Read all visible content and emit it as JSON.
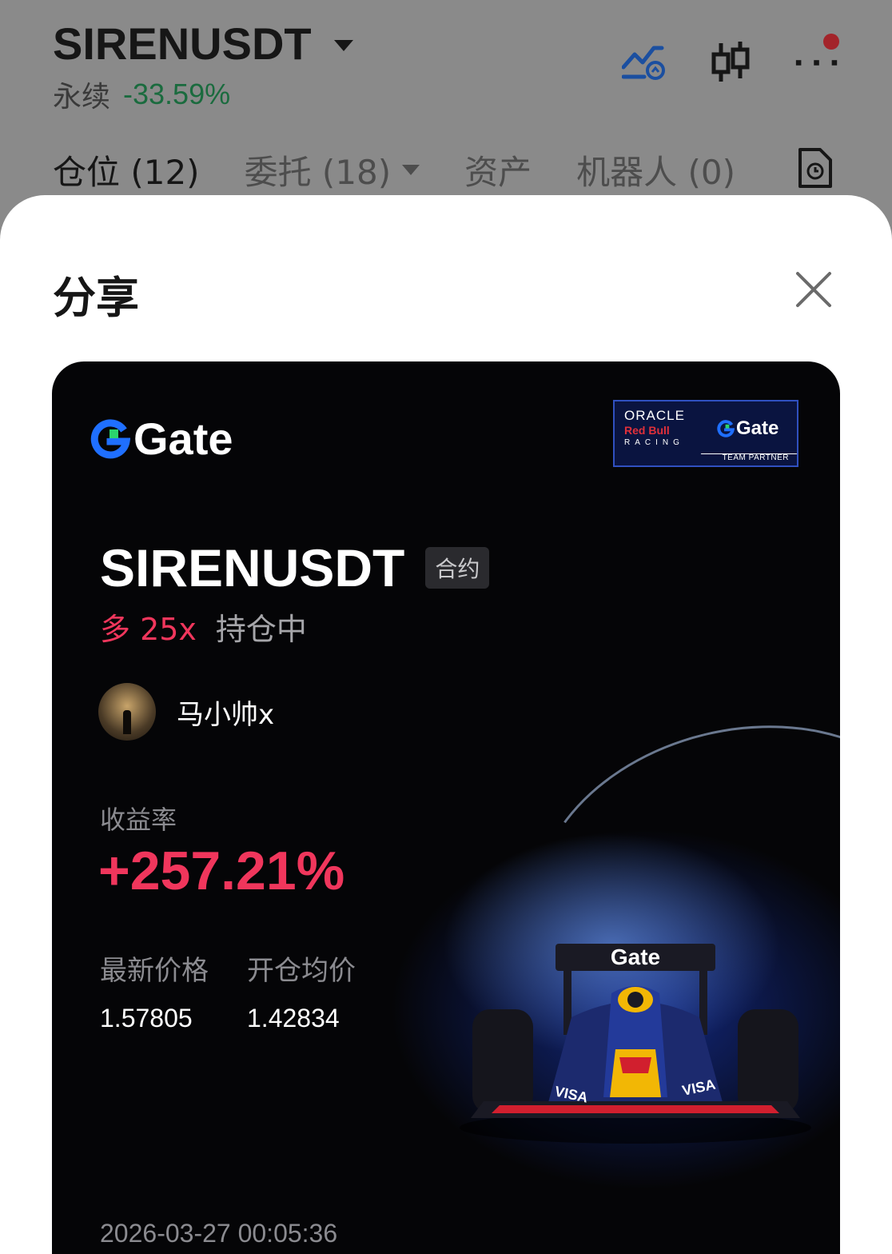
{
  "header": {
    "symbol": "SIRENUSDT",
    "contract_type": "永续",
    "change": "-33.59%"
  },
  "tabs": [
    {
      "label": "仓位 (12)"
    },
    {
      "label": "委托 (18)"
    },
    {
      "label": "资产"
    },
    {
      "label": "机器人 (0)"
    }
  ],
  "share_sheet": {
    "title": "分享"
  },
  "card": {
    "brand": "Gate",
    "partner": {
      "line1": "ORACLE",
      "line2": "Red Bull",
      "line3": "RACING",
      "brand": "Gate",
      "tag": "TEAM PARTNER"
    },
    "pair": "SIRENUSDT",
    "badge": "合约",
    "direction": "多 25x",
    "status": "持仓中",
    "username": "马小帅x",
    "roi_label": "收益率",
    "roi_value": "+257.21%",
    "latest_price_label": "最新价格",
    "latest_price": "1.57805",
    "entry_price_label": "开仓均价",
    "entry_price": "1.42834",
    "timestamp": "2026-03-27 00:05:36",
    "car_wing_text": "Gate"
  },
  "colors": {
    "profit": "#f0365c",
    "change_negative_dimmed": "#1a6b3e",
    "brand_blue": "#1f6fff",
    "brand_green": "#2bd46d"
  }
}
